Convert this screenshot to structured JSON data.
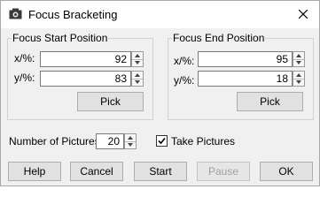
{
  "window": {
    "title": "Focus Bracketing",
    "close_icon": "close-icon",
    "app_icon": "camera-icon"
  },
  "start_group": {
    "title": "Focus Start Position",
    "x_label": "x/%:",
    "x_value": "92",
    "y_label": "y/%:",
    "y_value": "83",
    "pick_label": "Pick"
  },
  "end_group": {
    "title": "Focus End Position",
    "x_label": "x/%:",
    "x_value": "95",
    "y_label": "y/%:",
    "y_value": "18",
    "pick_label": "Pick"
  },
  "pictures": {
    "label": "Number of Pictures:",
    "value": "20"
  },
  "take_pictures": {
    "label": "Take Pictures",
    "checked": true
  },
  "buttons": {
    "help": "Help",
    "cancel": "Cancel",
    "start": "Start",
    "pause": "Pause",
    "ok": "OK"
  }
}
